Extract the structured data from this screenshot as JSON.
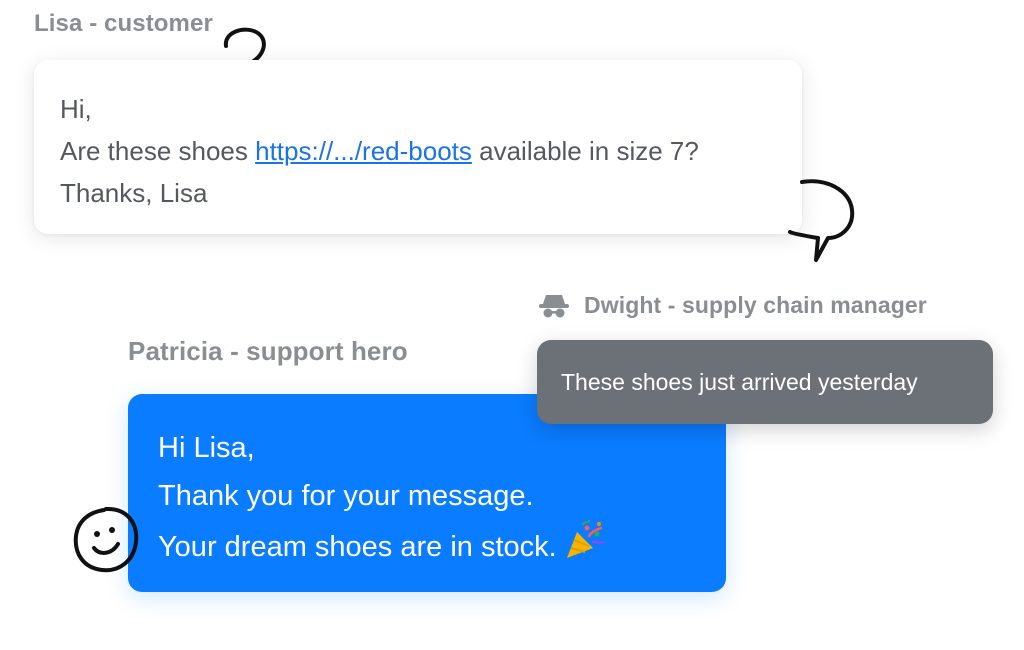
{
  "customer": {
    "name_label": "Lisa - customer",
    "message_lines": {
      "greeting": "Hi,",
      "question_prefix": "Are these shoes ",
      "link_text": "https://.../red-boots",
      "question_suffix": " available in size 7?",
      "signoff": "Thanks, Lisa"
    }
  },
  "internal_note": {
    "author_label": "Dwight - supply chain manager",
    "author_icon": "spy-icon",
    "text": "These shoes just arrived yesterday"
  },
  "agent": {
    "name_label": "Patricia - support hero",
    "message_lines": {
      "greeting": "Hi Lisa,",
      "thanks": "Thank you for your message.",
      "stock": "Your dream shoes are in stock."
    },
    "emoji_icon": "party-popper-icon"
  },
  "doodles": [
    "question-mark-doodle",
    "speech-bubble-doodle",
    "smiley-face-doodle"
  ],
  "colors": {
    "agent_bubble": "#0a7cff",
    "note_bubble": "#6c7077",
    "link": "#1a73e8",
    "label": "#8a8d91"
  }
}
